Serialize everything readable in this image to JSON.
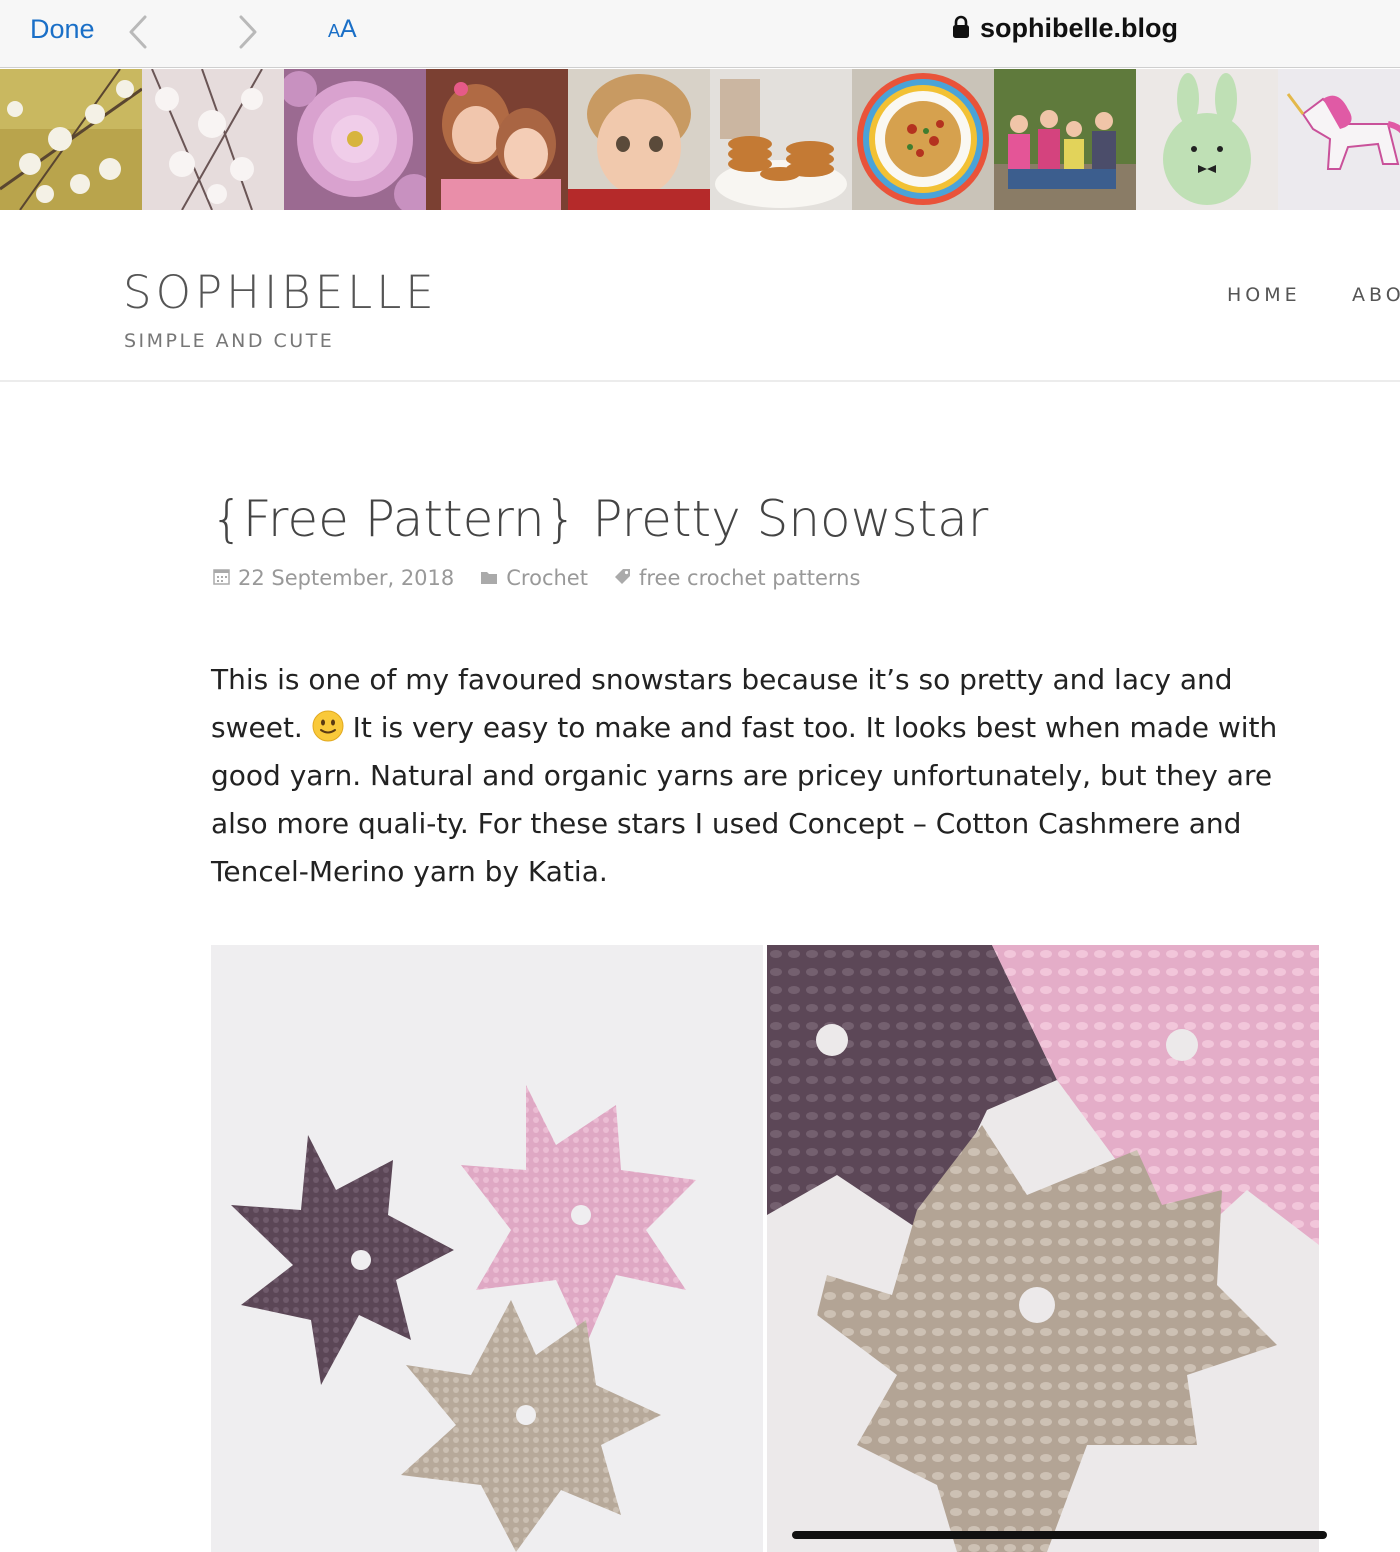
{
  "browser": {
    "done_label": "Done",
    "text_size_small": "A",
    "text_size_big": "A",
    "url": "sophibelle.blog",
    "accent_color": "#1a6fc7",
    "icons": [
      "back-chevron-icon",
      "forward-chevron-icon",
      "lock-icon"
    ]
  },
  "site": {
    "title": "SOPHIBELLE",
    "tagline": "SIMPLE AND CUTE",
    "menu": [
      {
        "label": "HOME"
      },
      {
        "label": "ABO"
      }
    ]
  },
  "post": {
    "title": "{Free Pattern} Pretty Snowstar",
    "date": "22 September, 2018",
    "category": "Crochet",
    "tag": "free crochet patterns",
    "body_before_emoji": "This is one of my favoured snowstars because it’s so pretty and lacy and sweet.",
    "body_after_emoji": "It is very easy to make and fast too. It looks best when made with good yarn. Natural and organic yarns are pricey unfortunately, but they are also more quali-ty. For these stars I used Concept – Cotton Cashmere and Tencel-Merino yarn by Katia."
  }
}
